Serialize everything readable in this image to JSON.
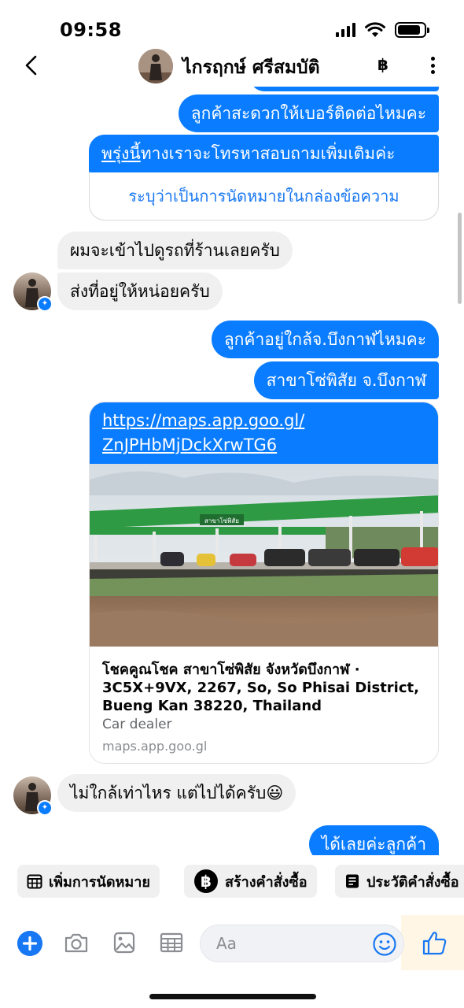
{
  "status_bar": {
    "time": "09:58"
  },
  "header": {
    "contact_name": "ไกรฤกษ์ ศรีสมบัติ",
    "baht_symbol": "฿"
  },
  "messages": {
    "m1": "ลูกค้าสะดวกให้เบอร์ติดต่อไหมคะ",
    "m2_underlined": "พรุ่งนี้",
    "m2_rest": "ทางเราจะโทรหาสอบถามเพิ่มเติมค่ะ",
    "m2_note": "ระบุว่าเป็นการนัดหมายในกล่องข้อความ",
    "m3": "ผมจะเข้าไปดูรถที่ร้านเลยครับ",
    "m4": "ส่งที่อยู่ให้หน่อยครับ",
    "m5": "ลูกค้าอยู่ใกล้จ.บึงกาฬไหมคะ",
    "m6": "สาขาโซ่พิสัย จ.บึงกาฬ",
    "link": {
      "url_line1": "https://maps.app.goo.gl/",
      "url_line2": "ZnJPHbMjDckXrwTG6",
      "photo_sign": "สาขาโซ่พิสัย",
      "title": "โชคคูณโชค สาขาโซ่พิสัย จังหวัดบึงกาฬ · 3C5X+9VX, 2267, So, So Phisai District, Bueng Kan 38220, Thailand",
      "type": "Car dealer",
      "domain": "maps.app.goo.gl"
    },
    "m7": "ไม่ใกล้เท่าไหร แต่ไปได้ครับ",
    "m7_emoji": "😃",
    "m8": "ได้เลยค่ะลูกค้า"
  },
  "quick_actions": [
    {
      "label": "เพิ่มการนัดหมาย",
      "icon": "calendar-icon"
    },
    {
      "label": "สร้างคำสั่งซื้อ",
      "icon": "baht-icon"
    },
    {
      "label": "ประวัติคำสั่งซื้อ",
      "icon": "receipt-icon"
    }
  ],
  "composer": {
    "placeholder": "Aa"
  },
  "colors": {
    "outgoing": "#0a7cff",
    "incoming": "#f0f0f0",
    "accent": "#1877f2"
  }
}
